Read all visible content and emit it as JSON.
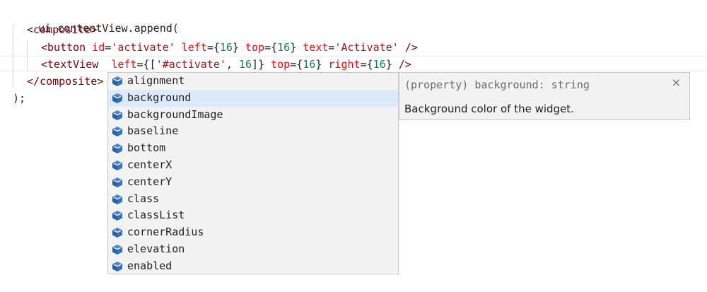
{
  "code": {
    "line1": {
      "obj": "ui.contentView.append("
    },
    "line2": {
      "open": "<",
      "tag": "composite",
      "close": ">"
    },
    "line3": {
      "open": "<",
      "tag": "button",
      "sp1": " ",
      "a1": "id",
      "eq1": "=",
      "v1": "'activate'",
      "sp2": " ",
      "a2": "left",
      "eq2": "={",
      "v2": "16",
      "cb2": "}",
      "sp3": " ",
      "a3": "top",
      "eq3": "={",
      "v3": "16",
      "cb3": "}",
      "sp4": " ",
      "a4": "text",
      "eq4": "=",
      "v4": "'Activate'",
      "end": " />"
    },
    "line4": {
      "open": "<",
      "tag": "textView",
      "sp1": "  ",
      "a1": "left",
      "eq1": "={[",
      "v1s": "'#activate'",
      "comma": ", ",
      "v1n": "16",
      "cb1": "]}",
      "sp2": " ",
      "a2": "top",
      "eq2": "={",
      "v2": "16",
      "cb2": "}",
      "sp3": " ",
      "a3": "right",
      "eq3": "={",
      "v3": "16",
      "cb3": "}",
      "end": " />"
    },
    "line5": {
      "open": "</",
      "tag": "composite",
      "close": ">"
    },
    "line6": {
      "text": ");"
    }
  },
  "suggestions": {
    "icon": "property-cube-icon",
    "selected_index": 1,
    "items": [
      "alignment",
      "background",
      "backgroundImage",
      "baseline",
      "bottom",
      "centerX",
      "centerY",
      "class",
      "classList",
      "cornerRadius",
      "elevation",
      "enabled"
    ]
  },
  "details": {
    "signature": "(property) background: string",
    "description": "Background color of the widget.",
    "close_glyph": "×"
  },
  "colors": {
    "tag": "#800000",
    "attribute": "#ff0000",
    "string": "#a31515",
    "number": "#09885a",
    "icon": "#1e64b4",
    "selected_row": "#dcebfc"
  }
}
